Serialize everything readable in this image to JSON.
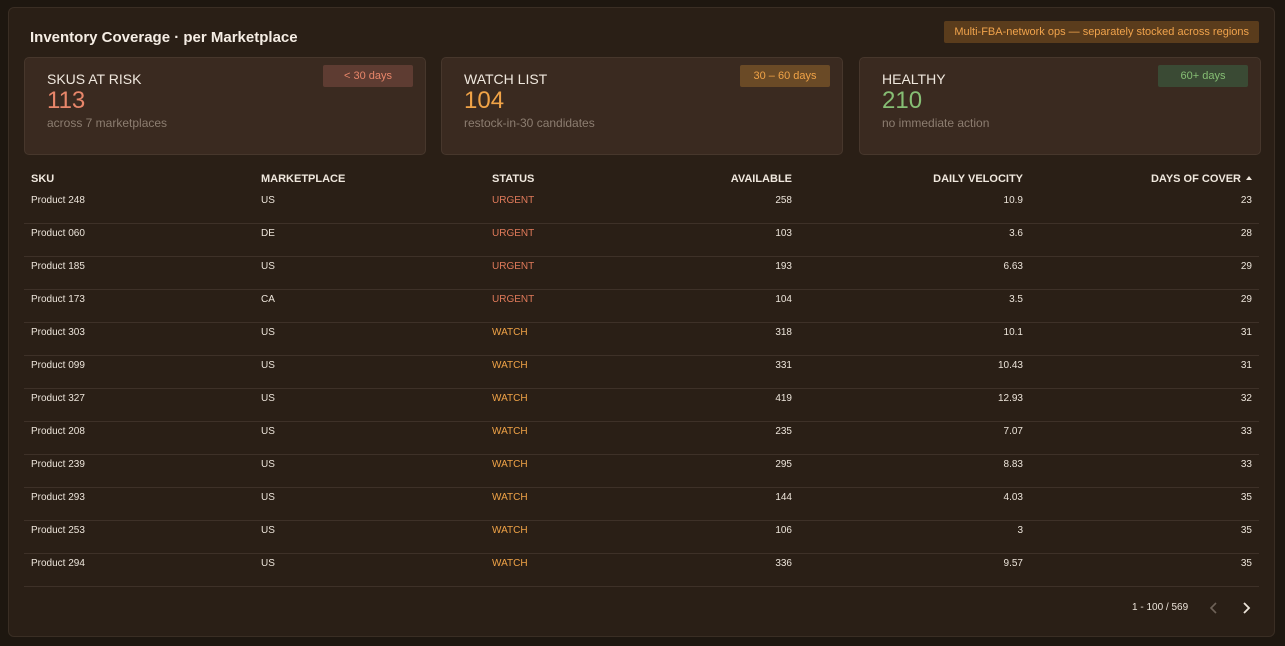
{
  "title": "Inventory Coverage · per Marketplace",
  "ops_badge": "Multi-FBA-network ops — separately stocked across regions",
  "cards": [
    {
      "label": "SKUS AT RISK",
      "value": "113",
      "sub": "across 7 marketplaces",
      "tag": "< 30 days",
      "color": "#e8866a"
    },
    {
      "label": "WATCH LIST",
      "value": "104",
      "sub": "restock-in-30 candidates",
      "tag": "30 – 60 days",
      "color": "#f0a347"
    },
    {
      "label": "HEALTHY",
      "value": "210",
      "sub": "no immediate action",
      "tag": "60+ days",
      "color": "#86be74"
    }
  ],
  "table": {
    "columns": [
      "SKU",
      "MARKETPLACE",
      "STATUS",
      "AVAILABLE",
      "DAILY VELOCITY",
      "DAYS OF COVER"
    ],
    "sort": {
      "column": "DAYS OF COVER",
      "direction": "ascending",
      "icon": "sort-ascending-icon"
    },
    "rows": [
      {
        "sku": "Product 248",
        "marketplace": "US",
        "status": "URGENT",
        "available": "258",
        "velocity": "10.9",
        "cover": "23"
      },
      {
        "sku": "Product 060",
        "marketplace": "DE",
        "status": "URGENT",
        "available": "103",
        "velocity": "3.6",
        "cover": "28"
      },
      {
        "sku": "Product 185",
        "marketplace": "US",
        "status": "URGENT",
        "available": "193",
        "velocity": "6.63",
        "cover": "29"
      },
      {
        "sku": "Product 173",
        "marketplace": "CA",
        "status": "URGENT",
        "available": "104",
        "velocity": "3.5",
        "cover": "29"
      },
      {
        "sku": "Product 303",
        "marketplace": "US",
        "status": "WATCH",
        "available": "318",
        "velocity": "10.1",
        "cover": "31"
      },
      {
        "sku": "Product 099",
        "marketplace": "US",
        "status": "WATCH",
        "available": "331",
        "velocity": "10.43",
        "cover": "31"
      },
      {
        "sku": "Product 327",
        "marketplace": "US",
        "status": "WATCH",
        "available": "419",
        "velocity": "12.93",
        "cover": "32"
      },
      {
        "sku": "Product 208",
        "marketplace": "US",
        "status": "WATCH",
        "available": "235",
        "velocity": "7.07",
        "cover": "33"
      },
      {
        "sku": "Product 239",
        "marketplace": "US",
        "status": "WATCH",
        "available": "295",
        "velocity": "8.83",
        "cover": "33"
      },
      {
        "sku": "Product 293",
        "marketplace": "US",
        "status": "WATCH",
        "available": "144",
        "velocity": "4.03",
        "cover": "35"
      },
      {
        "sku": "Product 253",
        "marketplace": "US",
        "status": "WATCH",
        "available": "106",
        "velocity": "3",
        "cover": "35"
      },
      {
        "sku": "Product 294",
        "marketplace": "US",
        "status": "WATCH",
        "available": "336",
        "velocity": "9.57",
        "cover": "35"
      }
    ]
  },
  "pagination": {
    "info": "1 - 100 / 569",
    "prev_icon": "chevron-left-icon",
    "next_icon": "chevron-right-icon"
  },
  "colors": {
    "background": "#1e1710",
    "panel": "#2a1f16",
    "urgent": "#e07a5a",
    "watch": "#f0a347",
    "healthy": "#86be74",
    "ops_badge": "#f0a34c"
  }
}
